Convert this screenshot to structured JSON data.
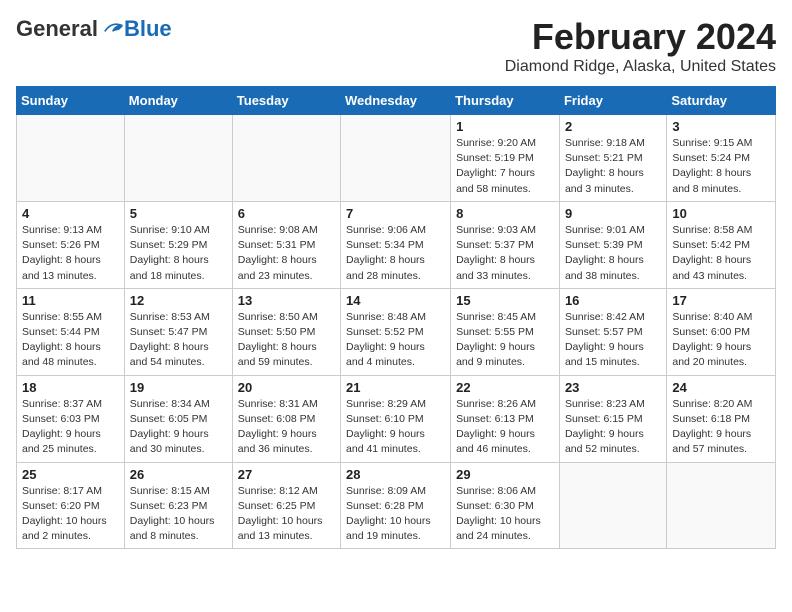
{
  "header": {
    "logo_general": "General",
    "logo_blue": "Blue",
    "title": "February 2024",
    "subtitle": "Diamond Ridge, Alaska, United States"
  },
  "days": [
    "Sunday",
    "Monday",
    "Tuesday",
    "Wednesday",
    "Thursday",
    "Friday",
    "Saturday"
  ],
  "weeks": [
    [
      {
        "date": "",
        "info": ""
      },
      {
        "date": "",
        "info": ""
      },
      {
        "date": "",
        "info": ""
      },
      {
        "date": "",
        "info": ""
      },
      {
        "date": "1",
        "info": "Sunrise: 9:20 AM\nSunset: 5:19 PM\nDaylight: 7 hours\nand 58 minutes."
      },
      {
        "date": "2",
        "info": "Sunrise: 9:18 AM\nSunset: 5:21 PM\nDaylight: 8 hours\nand 3 minutes."
      },
      {
        "date": "3",
        "info": "Sunrise: 9:15 AM\nSunset: 5:24 PM\nDaylight: 8 hours\nand 8 minutes."
      }
    ],
    [
      {
        "date": "4",
        "info": "Sunrise: 9:13 AM\nSunset: 5:26 PM\nDaylight: 8 hours\nand 13 minutes."
      },
      {
        "date": "5",
        "info": "Sunrise: 9:10 AM\nSunset: 5:29 PM\nDaylight: 8 hours\nand 18 minutes."
      },
      {
        "date": "6",
        "info": "Sunrise: 9:08 AM\nSunset: 5:31 PM\nDaylight: 8 hours\nand 23 minutes."
      },
      {
        "date": "7",
        "info": "Sunrise: 9:06 AM\nSunset: 5:34 PM\nDaylight: 8 hours\nand 28 minutes."
      },
      {
        "date": "8",
        "info": "Sunrise: 9:03 AM\nSunset: 5:37 PM\nDaylight: 8 hours\nand 33 minutes."
      },
      {
        "date": "9",
        "info": "Sunrise: 9:01 AM\nSunset: 5:39 PM\nDaylight: 8 hours\nand 38 minutes."
      },
      {
        "date": "10",
        "info": "Sunrise: 8:58 AM\nSunset: 5:42 PM\nDaylight: 8 hours\nand 43 minutes."
      }
    ],
    [
      {
        "date": "11",
        "info": "Sunrise: 8:55 AM\nSunset: 5:44 PM\nDaylight: 8 hours\nand 48 minutes."
      },
      {
        "date": "12",
        "info": "Sunrise: 8:53 AM\nSunset: 5:47 PM\nDaylight: 8 hours\nand 54 minutes."
      },
      {
        "date": "13",
        "info": "Sunrise: 8:50 AM\nSunset: 5:50 PM\nDaylight: 8 hours\nand 59 minutes."
      },
      {
        "date": "14",
        "info": "Sunrise: 8:48 AM\nSunset: 5:52 PM\nDaylight: 9 hours\nand 4 minutes."
      },
      {
        "date": "15",
        "info": "Sunrise: 8:45 AM\nSunset: 5:55 PM\nDaylight: 9 hours\nand 9 minutes."
      },
      {
        "date": "16",
        "info": "Sunrise: 8:42 AM\nSunset: 5:57 PM\nDaylight: 9 hours\nand 15 minutes."
      },
      {
        "date": "17",
        "info": "Sunrise: 8:40 AM\nSunset: 6:00 PM\nDaylight: 9 hours\nand 20 minutes."
      }
    ],
    [
      {
        "date": "18",
        "info": "Sunrise: 8:37 AM\nSunset: 6:03 PM\nDaylight: 9 hours\nand 25 minutes."
      },
      {
        "date": "19",
        "info": "Sunrise: 8:34 AM\nSunset: 6:05 PM\nDaylight: 9 hours\nand 30 minutes."
      },
      {
        "date": "20",
        "info": "Sunrise: 8:31 AM\nSunset: 6:08 PM\nDaylight: 9 hours\nand 36 minutes."
      },
      {
        "date": "21",
        "info": "Sunrise: 8:29 AM\nSunset: 6:10 PM\nDaylight: 9 hours\nand 41 minutes."
      },
      {
        "date": "22",
        "info": "Sunrise: 8:26 AM\nSunset: 6:13 PM\nDaylight: 9 hours\nand 46 minutes."
      },
      {
        "date": "23",
        "info": "Sunrise: 8:23 AM\nSunset: 6:15 PM\nDaylight: 9 hours\nand 52 minutes."
      },
      {
        "date": "24",
        "info": "Sunrise: 8:20 AM\nSunset: 6:18 PM\nDaylight: 9 hours\nand 57 minutes."
      }
    ],
    [
      {
        "date": "25",
        "info": "Sunrise: 8:17 AM\nSunset: 6:20 PM\nDaylight: 10 hours\nand 2 minutes."
      },
      {
        "date": "26",
        "info": "Sunrise: 8:15 AM\nSunset: 6:23 PM\nDaylight: 10 hours\nand 8 minutes."
      },
      {
        "date": "27",
        "info": "Sunrise: 8:12 AM\nSunset: 6:25 PM\nDaylight: 10 hours\nand 13 minutes."
      },
      {
        "date": "28",
        "info": "Sunrise: 8:09 AM\nSunset: 6:28 PM\nDaylight: 10 hours\nand 19 minutes."
      },
      {
        "date": "29",
        "info": "Sunrise: 8:06 AM\nSunset: 6:30 PM\nDaylight: 10 hours\nand 24 minutes."
      },
      {
        "date": "",
        "info": ""
      },
      {
        "date": "",
        "info": ""
      }
    ]
  ]
}
